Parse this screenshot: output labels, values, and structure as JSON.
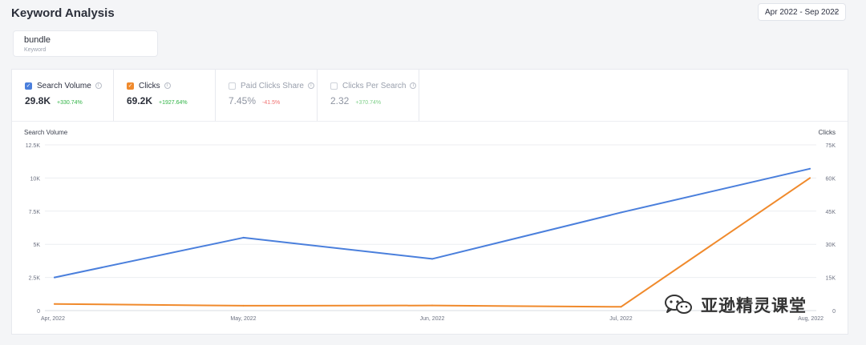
{
  "page": {
    "title": "Keyword Analysis",
    "date_range": "Apr 2022 - Sep 2022"
  },
  "keyword": {
    "value": "bundle",
    "label": "Keyword"
  },
  "metrics": [
    {
      "label": "Search Volume",
      "value": "29.8K",
      "change": "+330.74%",
      "checked": true,
      "color": "#4a7fdc",
      "change_color": "#2fb344"
    },
    {
      "label": "Clicks",
      "value": "69.2K",
      "change": "+1927.64%",
      "checked": true,
      "color": "#f08a2c",
      "change_color": "#2fb344"
    },
    {
      "label": "Paid Clicks Share",
      "value": "7.45%",
      "change": "-41.5%",
      "checked": false,
      "color": "#cfd3da",
      "change_color": "#f07070"
    },
    {
      "label": "Clicks Per Search",
      "value": "2.32",
      "change": "+370.74%",
      "checked": false,
      "color": "#cfd3da",
      "change_color": "#7fd08a"
    }
  ],
  "chart_data": {
    "type": "line",
    "categories": [
      "Apr, 2022",
      "May, 2022",
      "Jun, 2022",
      "Jul, 2022",
      "Aug, 2022"
    ],
    "ylabel_left": "Search Volume",
    "ylabel_right": "Clicks",
    "y_left_ticks": [
      "0",
      "2.5K",
      "5K",
      "7.5K",
      "10K",
      "12.5K"
    ],
    "y_right_ticks": [
      "0",
      "15K",
      "30K",
      "45K",
      "60K",
      "75K"
    ],
    "ylim_left": [
      0,
      12500
    ],
    "ylim_right": [
      0,
      75000
    ],
    "grid": true,
    "series": [
      {
        "name": "Search Volume",
        "axis": "left",
        "color": "#4a7fdc",
        "values": [
          2500,
          5500,
          3900,
          7400,
          10700
        ]
      },
      {
        "name": "Clicks",
        "axis": "right",
        "color": "#f08a2c",
        "values": [
          3000,
          2200,
          2300,
          1700,
          60000
        ]
      }
    ]
  },
  "watermark": {
    "text": "亚逊精灵课堂",
    "icon": "wechat-icon"
  }
}
